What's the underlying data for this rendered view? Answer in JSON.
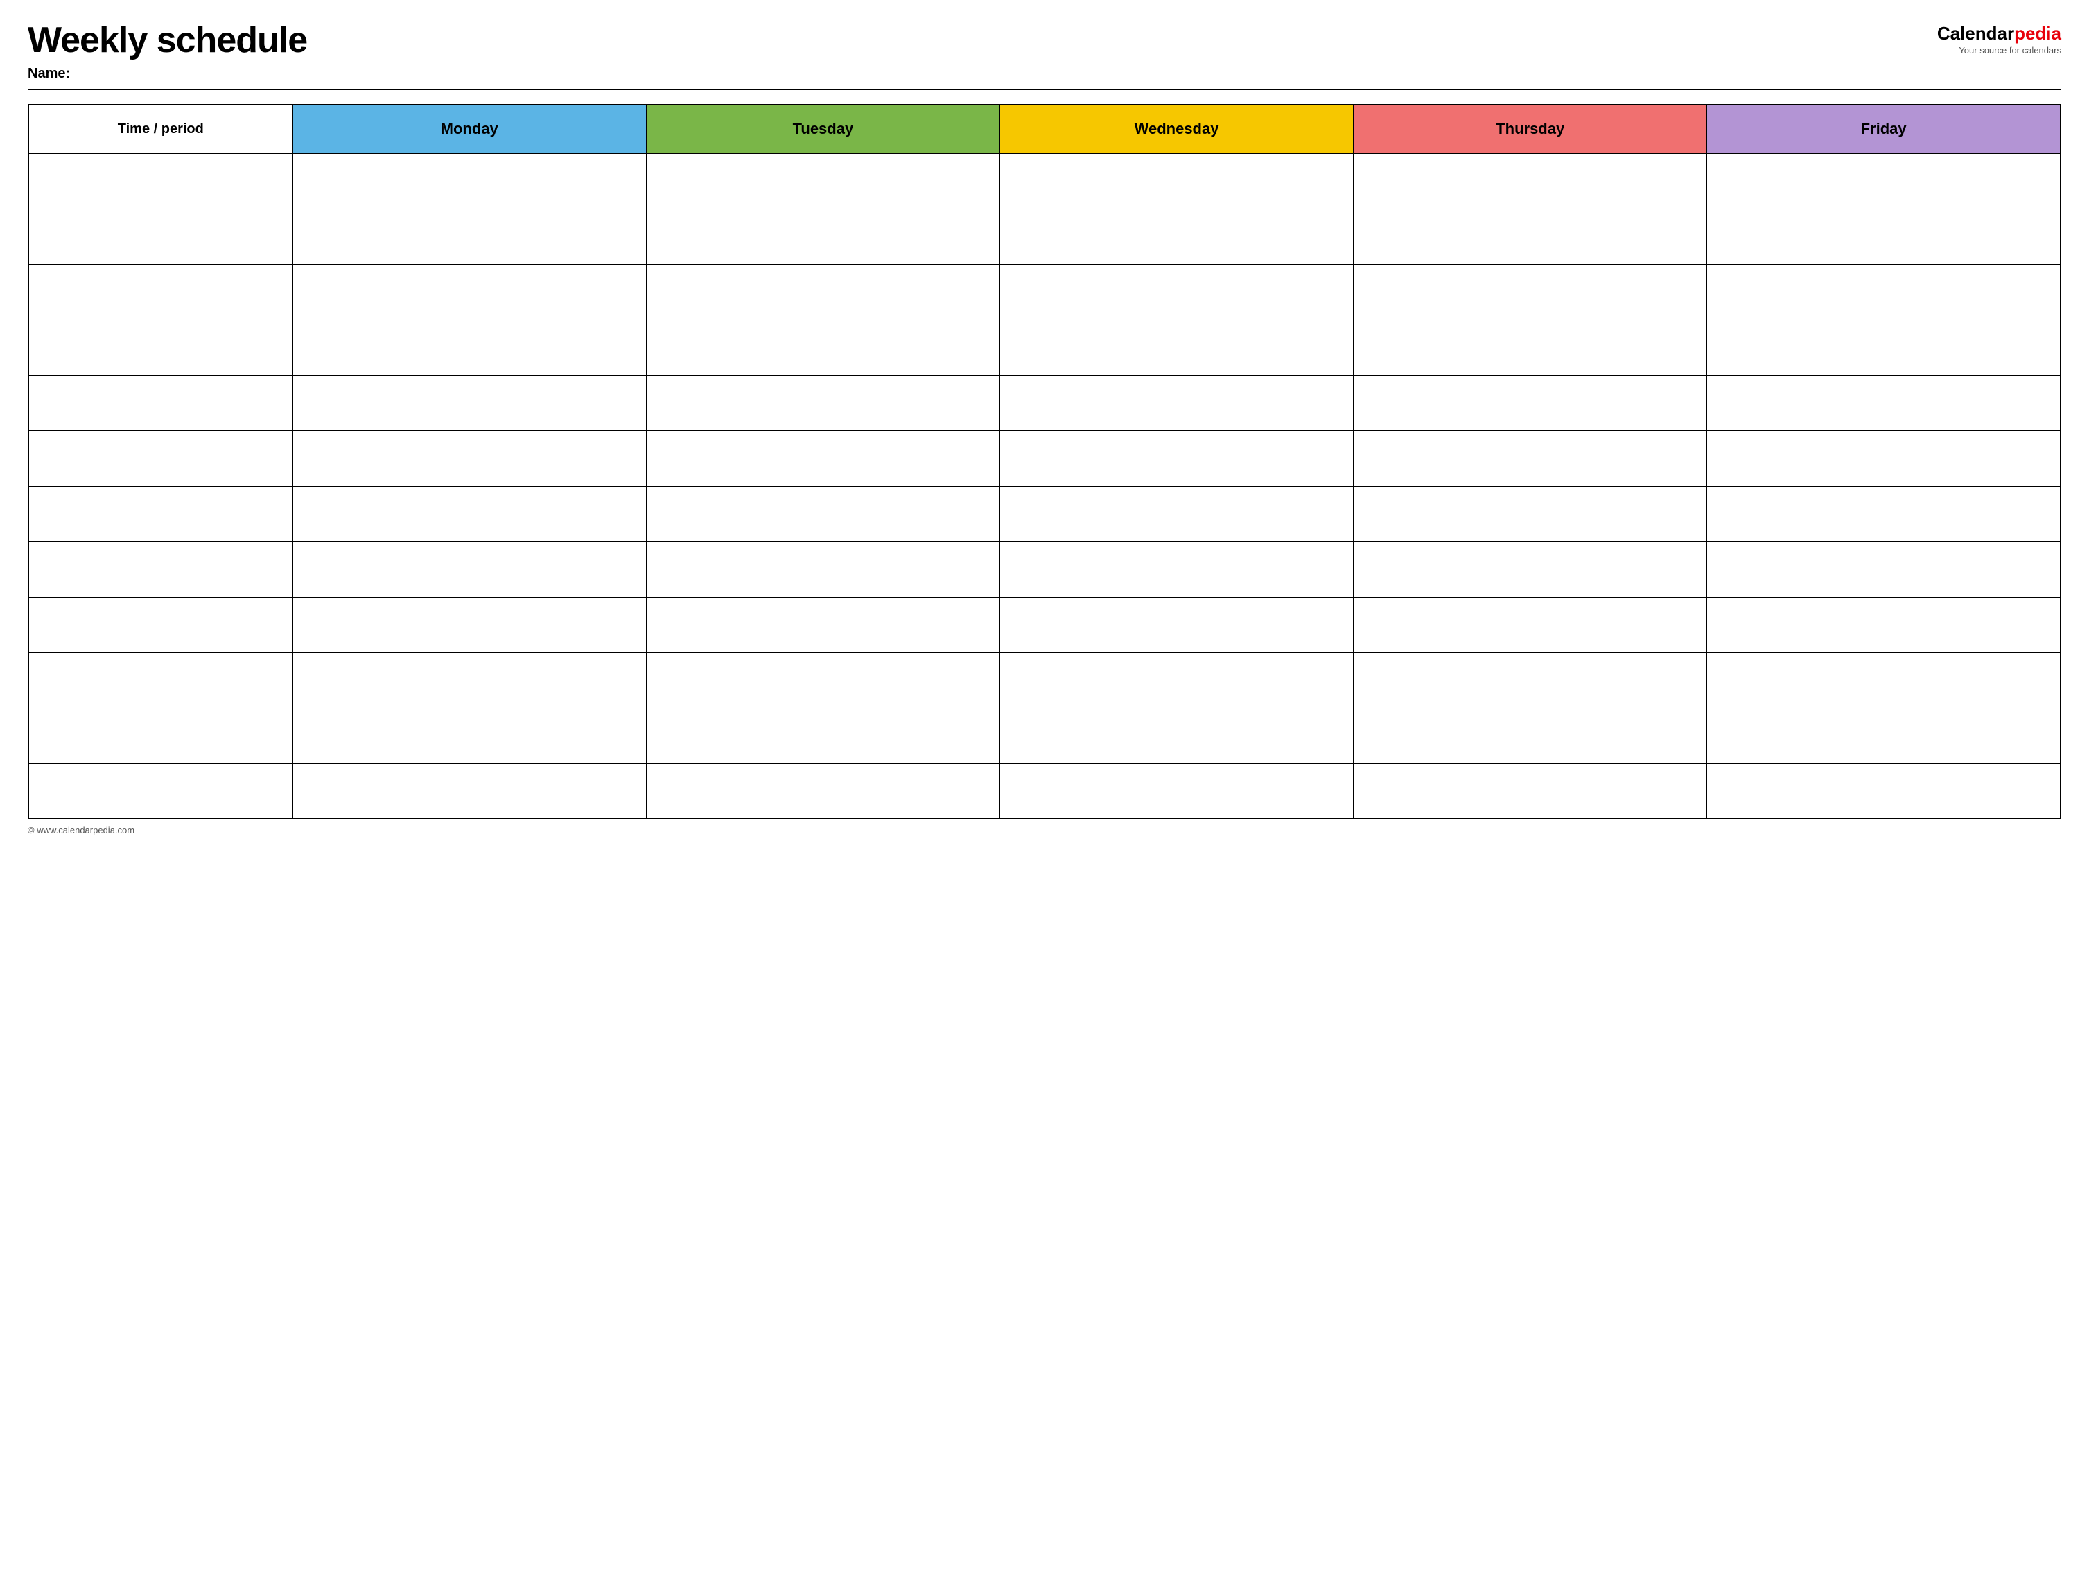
{
  "header": {
    "title": "Weekly schedule",
    "name_label": "Name:",
    "logo_calendar": "Calendar",
    "logo_pedia": "pedia",
    "logo_tagline": "Your source for calendars"
  },
  "table": {
    "columns": [
      {
        "id": "time",
        "label": "Time / period",
        "color_class": "time-header"
      },
      {
        "id": "monday",
        "label": "Monday",
        "color_class": "monday-header"
      },
      {
        "id": "tuesday",
        "label": "Tuesday",
        "color_class": "tuesday-header"
      },
      {
        "id": "wednesday",
        "label": "Wednesday",
        "color_class": "wednesday-header"
      },
      {
        "id": "thursday",
        "label": "Thursday",
        "color_class": "thursday-header"
      },
      {
        "id": "friday",
        "label": "Friday",
        "color_class": "friday-header"
      }
    ],
    "rows": 12
  },
  "footer": {
    "copyright": "© www.calendarpedia.com"
  }
}
